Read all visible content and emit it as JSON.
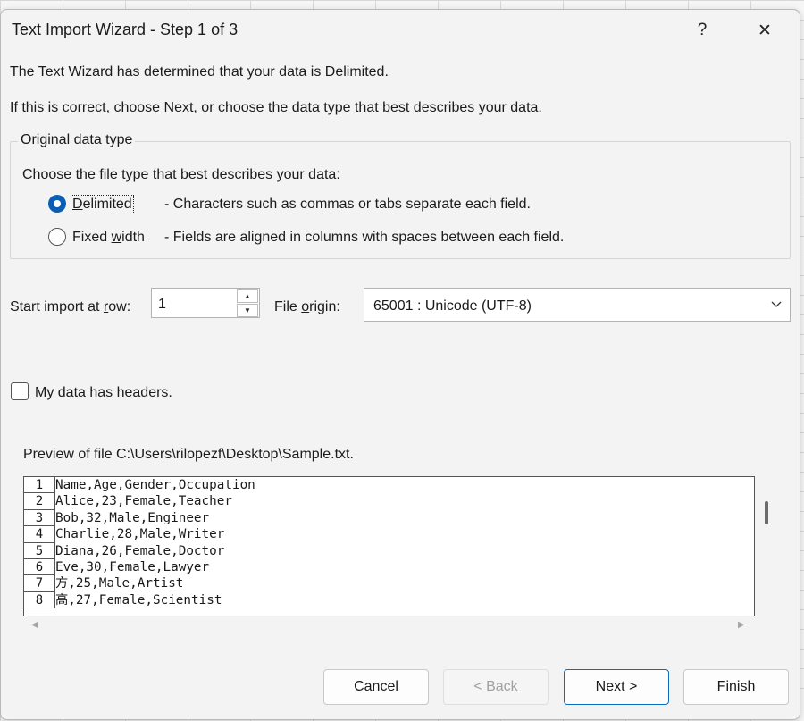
{
  "window": {
    "title": "Text Import Wizard - Step 1 of 3",
    "help_glyph": "?",
    "close_glyph": "✕"
  },
  "intro": {
    "line1": "The Text Wizard has determined that your data is Delimited.",
    "line2": "If this is correct, choose Next, or choose the data type that best describes your data."
  },
  "original_data_type": {
    "group_title": "Original data type",
    "prompt": "Choose the file type that best describes your data:",
    "options": [
      {
        "label_pre": "",
        "label_key": "D",
        "label_post": "elimited",
        "description": "- Characters such as commas or tabs separate each field.",
        "selected": true
      },
      {
        "label_pre": "Fixed ",
        "label_key": "w",
        "label_post": "idth",
        "description": "- Fields are aligned in columns with spaces between each field.",
        "selected": false
      }
    ]
  },
  "start_row": {
    "label_pre": "Start import at ",
    "label_key": "r",
    "label_post": "ow:",
    "value": "1"
  },
  "file_origin": {
    "label_pre": "File ",
    "label_key": "o",
    "label_post": "rigin:",
    "value": "65001 : Unicode (UTF-8)"
  },
  "headers_checkbox": {
    "label_key": "M",
    "label_post": "y data has headers.",
    "checked": false
  },
  "preview": {
    "caption": "Preview of file C:\\Users\\rilopezf\\Desktop\\Sample.txt.",
    "rows": [
      {
        "num": "1",
        "text": "Name,Age,Gender,Occupation"
      },
      {
        "num": "2",
        "text": "Alice,23,Female,Teacher"
      },
      {
        "num": "3",
        "text": "Bob,32,Male,Engineer"
      },
      {
        "num": "4",
        "text": "Charlie,28,Male,Writer"
      },
      {
        "num": "5",
        "text": "Diana,26,Female,Doctor"
      },
      {
        "num": "6",
        "text": "Eve,30,Female,Lawyer"
      },
      {
        "num": "7",
        "text": "方,25,Male,Artist"
      },
      {
        "num": "8",
        "text": "高,27,Female,Scientist"
      }
    ]
  },
  "buttons": {
    "cancel": "Cancel",
    "back": "< Back",
    "next_key": "N",
    "next_post": "ext >",
    "finish_key": "F",
    "finish_post": "inish"
  },
  "colors": {
    "accent": "#0a5fb4",
    "dialog_bg": "#f3f3f3"
  }
}
